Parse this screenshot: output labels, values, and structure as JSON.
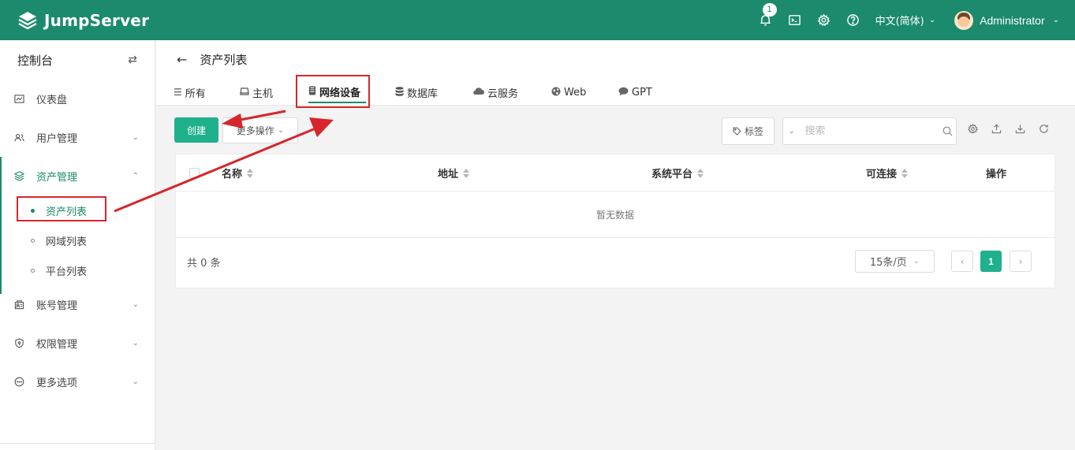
{
  "topbar": {
    "brand": "JumpServer",
    "notification_count": "1",
    "language": "中文(简体)",
    "username": "Administrator"
  },
  "sidebar": {
    "title": "控制台",
    "items": [
      {
        "label": "仪表盘",
        "icon": "dashboard-icon"
      },
      {
        "label": "用户管理",
        "icon": "users-icon"
      },
      {
        "label": "资产管理",
        "icon": "assets-icon"
      },
      {
        "label": "账号管理",
        "icon": "accounts-icon"
      },
      {
        "label": "权限管理",
        "icon": "shield-icon"
      },
      {
        "label": "更多选项",
        "icon": "more-icon"
      }
    ],
    "sub_items": [
      "资产列表",
      "网域列表",
      "平台列表"
    ]
  },
  "page": {
    "title": "资产列表",
    "tabs": [
      {
        "label": "所有",
        "icon": "list-icon"
      },
      {
        "label": "主机",
        "icon": "host-icon"
      },
      {
        "label": "网络设备",
        "icon": "network-device-icon"
      },
      {
        "label": "数据库",
        "icon": "database-icon"
      },
      {
        "label": "云服务",
        "icon": "cloud-icon"
      },
      {
        "label": "Web",
        "icon": "globe-icon"
      },
      {
        "label": "GPT",
        "icon": "chat-icon"
      }
    ],
    "active_tab": "网络设备"
  },
  "toolbar": {
    "create_label": "创建",
    "more_actions_label": "更多操作",
    "tag_label": "标签",
    "search_placeholder": "搜索"
  },
  "table": {
    "columns": [
      "名称",
      "地址",
      "系统平台",
      "可连接",
      "操作"
    ],
    "empty_text": "暂无数据",
    "total_text": "共 0 条",
    "page_size": "15条/页",
    "current_page": "1"
  },
  "colors": {
    "brand": "#1b8a6d",
    "button": "#1fb08c",
    "annotation": "#d6262b"
  }
}
